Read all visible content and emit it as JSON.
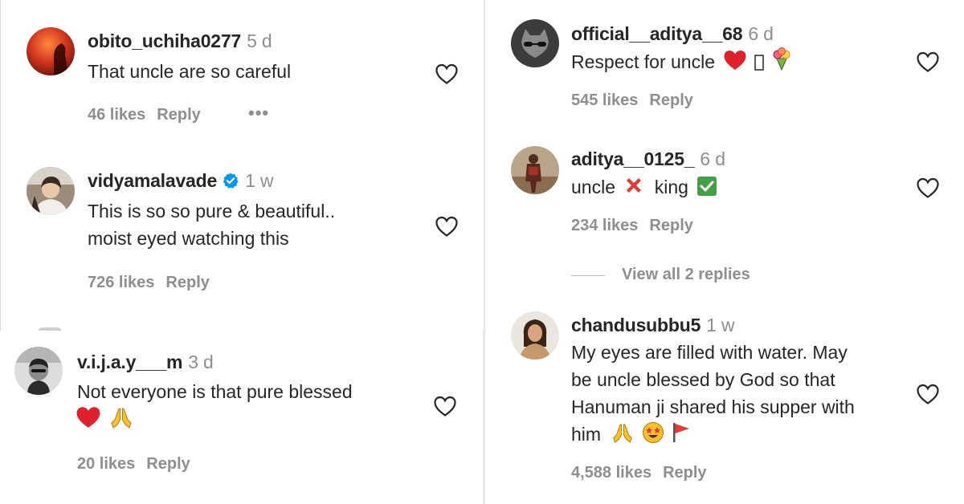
{
  "comments_left_top": [
    {
      "username": "obito_uchiha0277",
      "time": "5 d",
      "text": [
        "That uncle are so careful"
      ],
      "likes": "46 likes",
      "reply": "Reply",
      "more": "•••"
    },
    {
      "username": "vidyamalavade",
      "time": "1 w",
      "verified": true,
      "text": [
        "This is so so pure & beautiful..",
        "moist eyed watching this"
      ],
      "likes": "726 likes",
      "reply": "Reply"
    }
  ],
  "comments_left_bottom": [
    {
      "username": "v.i.j.a.y___m",
      "time": "3 d",
      "text": [
        "Not everyone is that pure blessed"
      ],
      "emojis": [
        "red-heart",
        "folded-hands"
      ],
      "likes": "20 likes",
      "reply": "Reply"
    }
  ],
  "comments_right": [
    {
      "username": "official__aditya__68",
      "time": "6 d",
      "text": [
        "Respect for uncle"
      ],
      "emojis": [
        "red-heart",
        "missing-glyph",
        "bouquet"
      ],
      "likes": "545 likes",
      "reply": "Reply"
    },
    {
      "username": "aditya__0125_",
      "time": "6 d",
      "text": [
        "uncle",
        "king"
      ],
      "emojis": [
        "cross-mark",
        "check-mark-button"
      ],
      "likes": "234 likes",
      "reply": "Reply",
      "view_replies": "View all 2 replies"
    },
    {
      "username": "chandusubbu5",
      "time": "1 w",
      "text": [
        "My eyes are filled with water. May",
        "be uncle blessed by God so that",
        "Hanuman ji shared his supper with",
        "him"
      ],
      "emojis": [
        "folded-hands",
        "star-struck",
        "triangular-flag"
      ],
      "likes": "4,588 likes",
      "reply": "Reply"
    }
  ],
  "icons": {
    "like": "heart-outline-icon",
    "verified": "verified-badge-icon"
  },
  "colors": {
    "text": "#262626",
    "muted": "#8e8e8e",
    "verified": "#0095f6",
    "heart_red": "#e0202a"
  }
}
